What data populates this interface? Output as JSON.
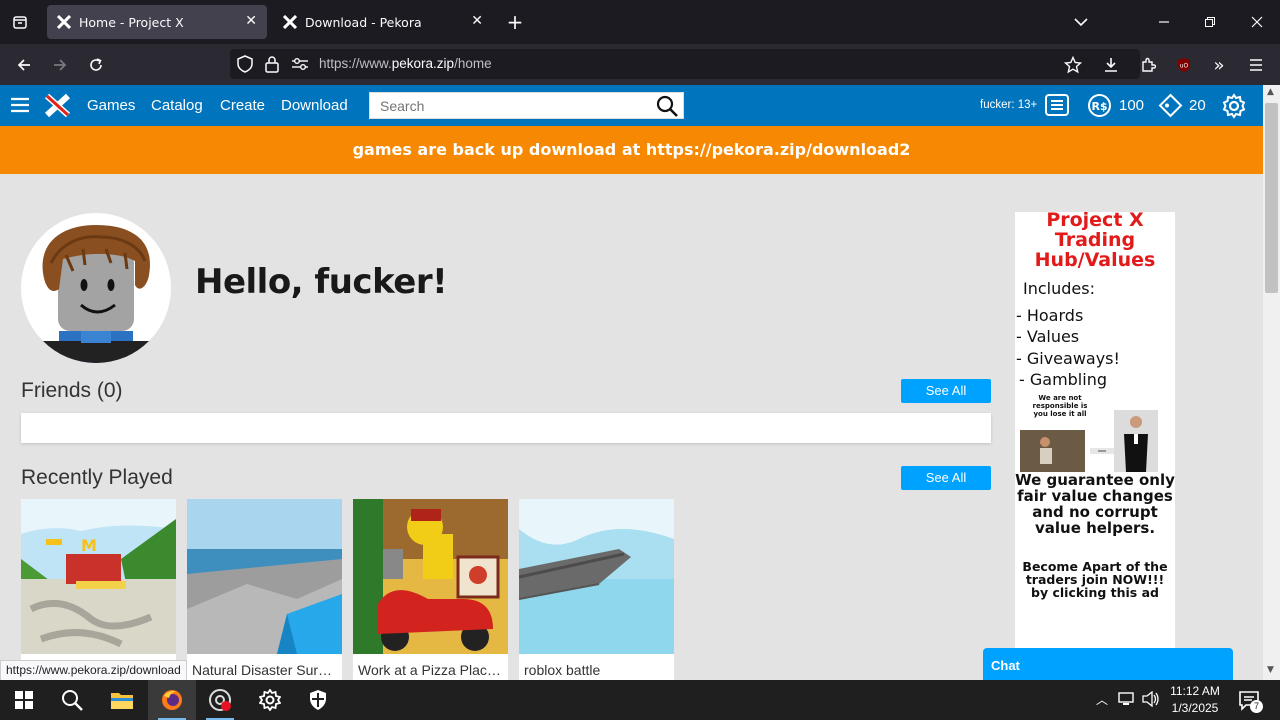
{
  "browser": {
    "tabs": [
      {
        "title": "Home - Project X",
        "active": true
      },
      {
        "title": "Download - Pekora",
        "active": false
      }
    ],
    "url_prefix": "https://www.",
    "url_domain": "pekora.zip",
    "url_path": "/home",
    "status_url": "https://www.pekora.zip/download"
  },
  "site": {
    "nav": [
      "Games",
      "Catalog",
      "Create",
      "Download"
    ],
    "search_placeholder": "Search",
    "username_age": "fucker: 13+",
    "robux": "100",
    "tix": "20",
    "banner": "games are back up download at https://pekora.zip/download2",
    "greeting": "Hello, fucker!",
    "friends_title": "Friends (0)",
    "recent_title": "Recently Played",
    "see_all": "See All",
    "games": [
      {
        "name": ""
      },
      {
        "name": "Natural Disaster Sur…"
      },
      {
        "name": "Work at a Pizza Plac…"
      },
      {
        "name": "roblox battle"
      }
    ],
    "chat_label": "Chat"
  },
  "ad": {
    "title": "Project X Trading Hub/Values",
    "includes": "Includes:",
    "items": [
      "- Hoards",
      "- Values",
      "- Giveaways!",
      "- Gambling"
    ],
    "disclaimer": "We are not responsible is you lose it all",
    "guarantee": "We guarantee only fair value changes and no corrupt value helpers.",
    "cta": "Become Apart of the traders join NOW!!! by clicking this ad"
  },
  "taskbar": {
    "time": "11:12 AM",
    "date": "1/3/2025",
    "notifications": "7"
  },
  "colors": {
    "header_blue": "#0074bd",
    "banner_orange": "#f68802",
    "button_blue": "#00a2ff",
    "ad_red": "#e21a1a"
  }
}
